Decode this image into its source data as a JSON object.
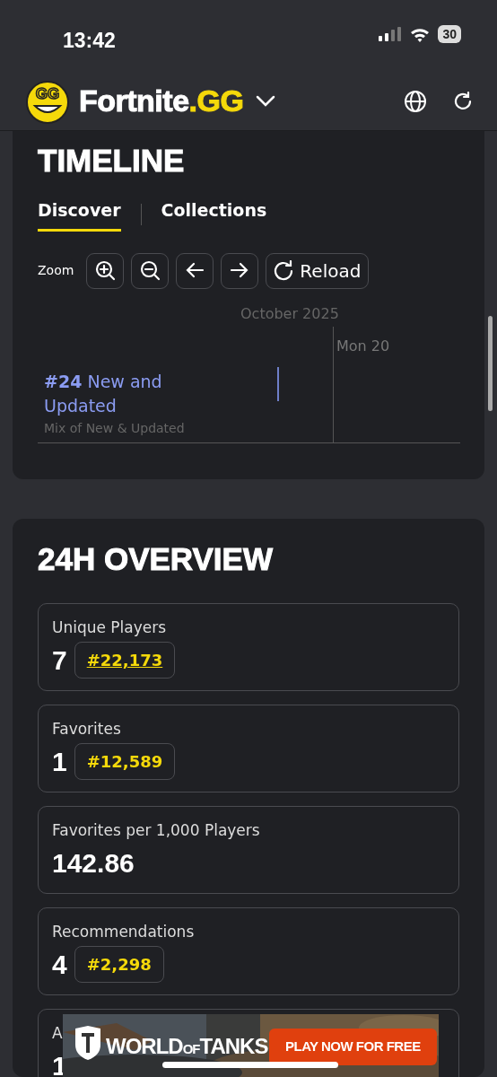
{
  "status_bar": {
    "time": "13:42",
    "battery": "30"
  },
  "header": {
    "logo_text": "GG",
    "brand": "Fortnite",
    "brand_suffix": ".GG"
  },
  "timeline": {
    "title": "TIMELINE",
    "tabs": [
      {
        "label": "Discover",
        "selected": true
      },
      {
        "label": "Collections",
        "selected": false
      }
    ],
    "zoom_label": "Zoom",
    "toolbar": [
      {
        "kind": "zoom-in"
      },
      {
        "kind": "zoom-out"
      },
      {
        "kind": "back"
      },
      {
        "kind": "forward"
      },
      {
        "kind": "reload",
        "label": "Reload"
      }
    ],
    "month": "October 2025",
    "day": "Mon 20",
    "entry": {
      "rank": "#24",
      "title": "New and Updated",
      "subtitle": "Mix of New & Updated"
    }
  },
  "overview": {
    "title": "24H OVERVIEW",
    "stats": [
      {
        "label": "Unique Players",
        "value": "7",
        "rank": "#22,173",
        "linked": true
      },
      {
        "label": "Favorites",
        "value": "1",
        "rank": "#12,589",
        "linked": false
      },
      {
        "label": "Favorites per 1,000 Players",
        "value": "142.86"
      },
      {
        "label": "Recommendations",
        "value": "4",
        "rank": "#2,298",
        "linked": false
      },
      {
        "label": "A",
        "value": "1"
      }
    ]
  },
  "ad": {
    "brand": [
      "WORLD",
      "OF",
      "TANKS"
    ],
    "cta": "PLAY NOW FOR FREE"
  }
}
